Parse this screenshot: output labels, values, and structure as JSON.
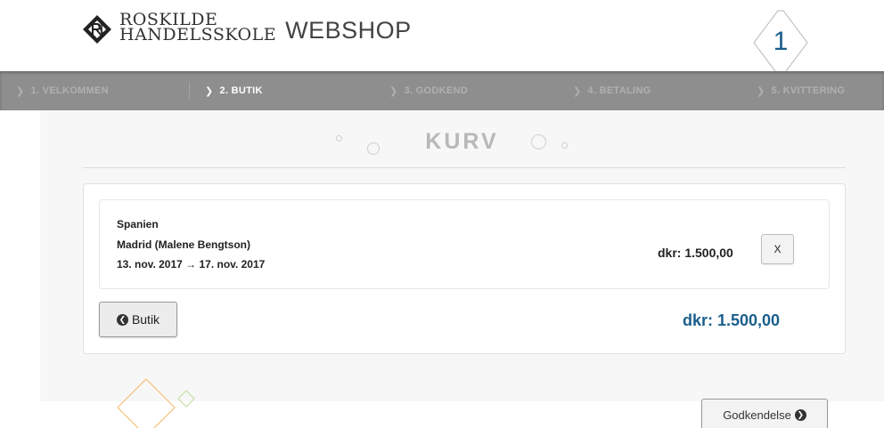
{
  "header": {
    "school_line1": "ROSKILDE",
    "school_line2": "HANDELSSKOLE",
    "webshop": "WEBSHOP",
    "cart_count": "1"
  },
  "steps": [
    {
      "label": "1.  VELKOMMEN",
      "active": false
    },
    {
      "label": "2.  BUTIK",
      "active": true
    },
    {
      "label": "3.  GODKEND",
      "active": false
    },
    {
      "label": "4.  BETALING",
      "active": false
    },
    {
      "label": "5.  KVITTERING",
      "active": false
    }
  ],
  "cart": {
    "title": "KURV",
    "item": {
      "country": "Spanien",
      "city_person": "Madrid (Malene Bengtson)",
      "dates": "13. nov. 2017 → 17. nov. 2017",
      "price": "dkr: 1.500,00",
      "remove_label": "X"
    },
    "back_label": "Butik",
    "total": "dkr: 1.500,00",
    "next_label": "Godkendelse"
  },
  "icons": {
    "logo": "roskilde-logo-icon",
    "step_chevron": "chevron-right-icon",
    "back": "circle-chevron-left-icon",
    "next": "circle-chevron-right-icon"
  },
  "colors": {
    "accent": "#1a5e8c",
    "steps_bar": "#8e8e8e",
    "deco_orange": "#f5c07a",
    "deco_green": "#c5dfa4"
  }
}
